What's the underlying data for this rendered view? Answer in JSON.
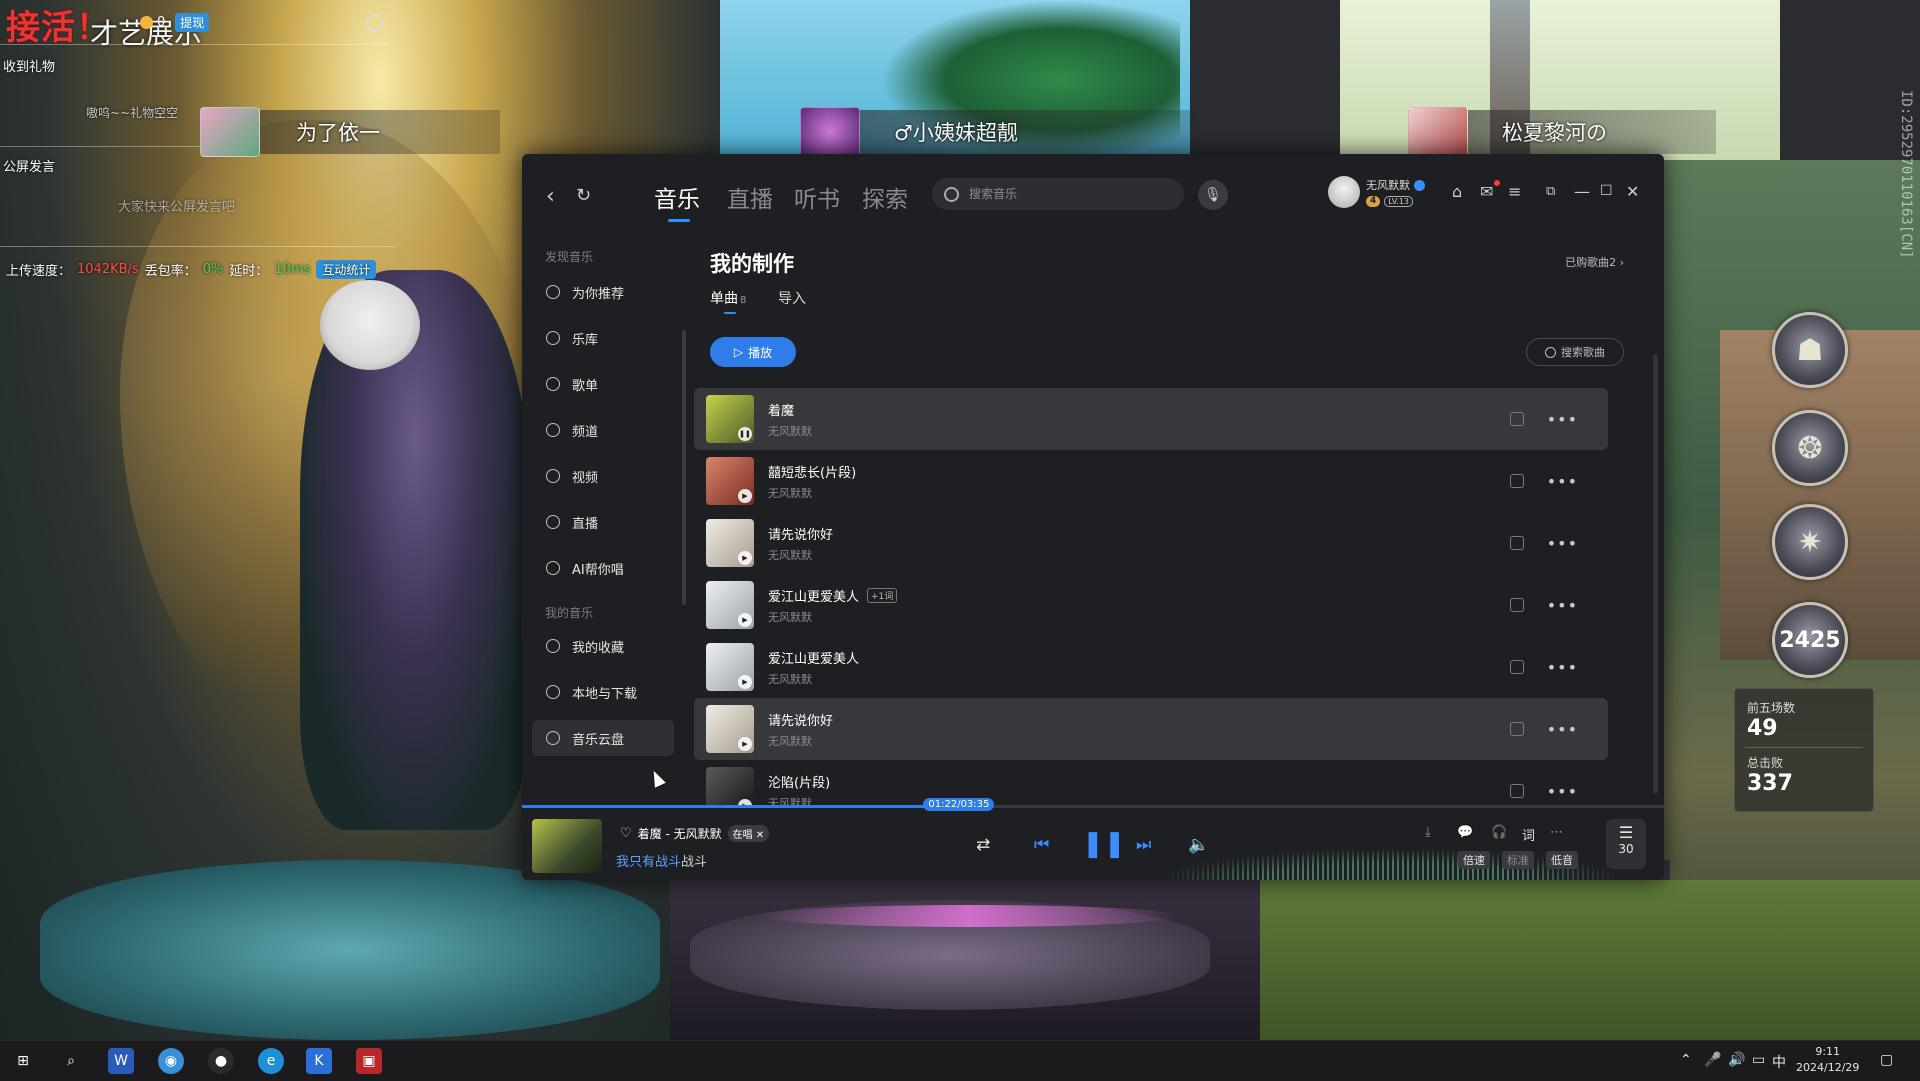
{
  "overlay": {
    "watermark": "接活！",
    "show_title": "才艺展示",
    "coin_count": "0",
    "withdraw_label": "提现",
    "gift_header": "收到礼物",
    "gift_placeholder": "嗷呜~~礼物空空",
    "chat_header": "公屏发言",
    "chat_placeholder": "大家快来公屏发言吧",
    "upload_label": "上传速度：",
    "upload_value": "1042KB/s",
    "loss_label": "丢包率：",
    "loss_value": "0%",
    "latency_label": "延时：",
    "latency_value": "10ms",
    "interact_label": "互动统计"
  },
  "players": [
    {
      "name": "为了依一"
    },
    {
      "name": "♂小姨妹超靓"
    },
    {
      "name": "松夏黎河の"
    }
  ],
  "vertical_id": "ID:2952970110163[CN]",
  "hud": {
    "score": "2425",
    "top5_label": "前五场数",
    "top5_value": "49",
    "kills_label": "总击败",
    "kills_value": "337"
  },
  "app": {
    "nav_back": "‹",
    "nav_refresh": "↻",
    "tabs": [
      {
        "label": "音乐",
        "active": true
      },
      {
        "label": "直播",
        "active": false
      },
      {
        "label": "听书",
        "active": false
      },
      {
        "label": "探索",
        "active": false
      }
    ],
    "search_placeholder": "搜索音乐",
    "user": {
      "name": "无风默默",
      "vip": "4",
      "level": "LV.13"
    },
    "sidebar": {
      "section_discover": "发现音乐",
      "discover_items": [
        {
          "label": "为你推荐",
          "icon": "recommend-icon"
        },
        {
          "label": "乐库",
          "icon": "library-icon"
        },
        {
          "label": "歌单",
          "icon": "playlist-icon"
        },
        {
          "label": "频道",
          "icon": "channel-icon"
        },
        {
          "label": "视频",
          "icon": "video-icon"
        },
        {
          "label": "直播",
          "icon": "live-icon"
        },
        {
          "label": "AI帮你唱",
          "icon": "ai-sing-icon"
        }
      ],
      "section_mine": "我的音乐",
      "mine_items": [
        {
          "label": "我的收藏",
          "icon": "heart-icon"
        },
        {
          "label": "本地与下载",
          "icon": "download-icon"
        },
        {
          "label": "音乐云盘",
          "icon": "cloud-icon"
        }
      ]
    },
    "content": {
      "title": "我的制作",
      "purchased": "已购歌曲2 ›",
      "sub_tabs": [
        {
          "label": "单曲",
          "count": "8",
          "active": true
        },
        {
          "label": "导入",
          "count": "",
          "active": false
        }
      ],
      "play_all": "播放",
      "song_search": "搜索歌曲",
      "songs": [
        {
          "title": "着魔",
          "artist": "无风默默",
          "tag": "",
          "highlight": true,
          "cover": "#9aa63a"
        },
        {
          "title": "囍短悲长(片段)",
          "artist": "无风默默",
          "tag": "",
          "highlight": false,
          "cover": "#c45a4a"
        },
        {
          "title": "请先说你好",
          "artist": "无风默默",
          "tag": "",
          "highlight": false,
          "cover": "#d8d2c8"
        },
        {
          "title": "爱江山更爱美人",
          "artist": "无风默默",
          "tag": "+1词",
          "highlight": false,
          "cover": "#cfd4d8"
        },
        {
          "title": "爱江山更爱美人",
          "artist": "无风默默",
          "tag": "",
          "highlight": false,
          "cover": "#cfd4d8"
        },
        {
          "title": "请先说你好",
          "artist": "无风默默",
          "tag": "",
          "highlight": true,
          "cover": "#d8d2c8"
        },
        {
          "title": "沦陷(片段)",
          "artist": "无风默默",
          "tag": "",
          "highlight": false,
          "cover": "#3a3a3a"
        }
      ]
    },
    "player": {
      "progress": 0.383,
      "time": "01:22/03:35",
      "now_title": "着魔 - 无风默默",
      "sing_badge": "在唱",
      "lyric_highlight": "我只有战斗",
      "lyric_rest": "战斗",
      "speed": "倍速",
      "quality_std": "标准",
      "quality_low": "低音",
      "lyric_btn": "词",
      "queue_count": "30"
    }
  },
  "taskbar": {
    "time": "9:11",
    "date": "2024/12/29",
    "ime": "中"
  }
}
